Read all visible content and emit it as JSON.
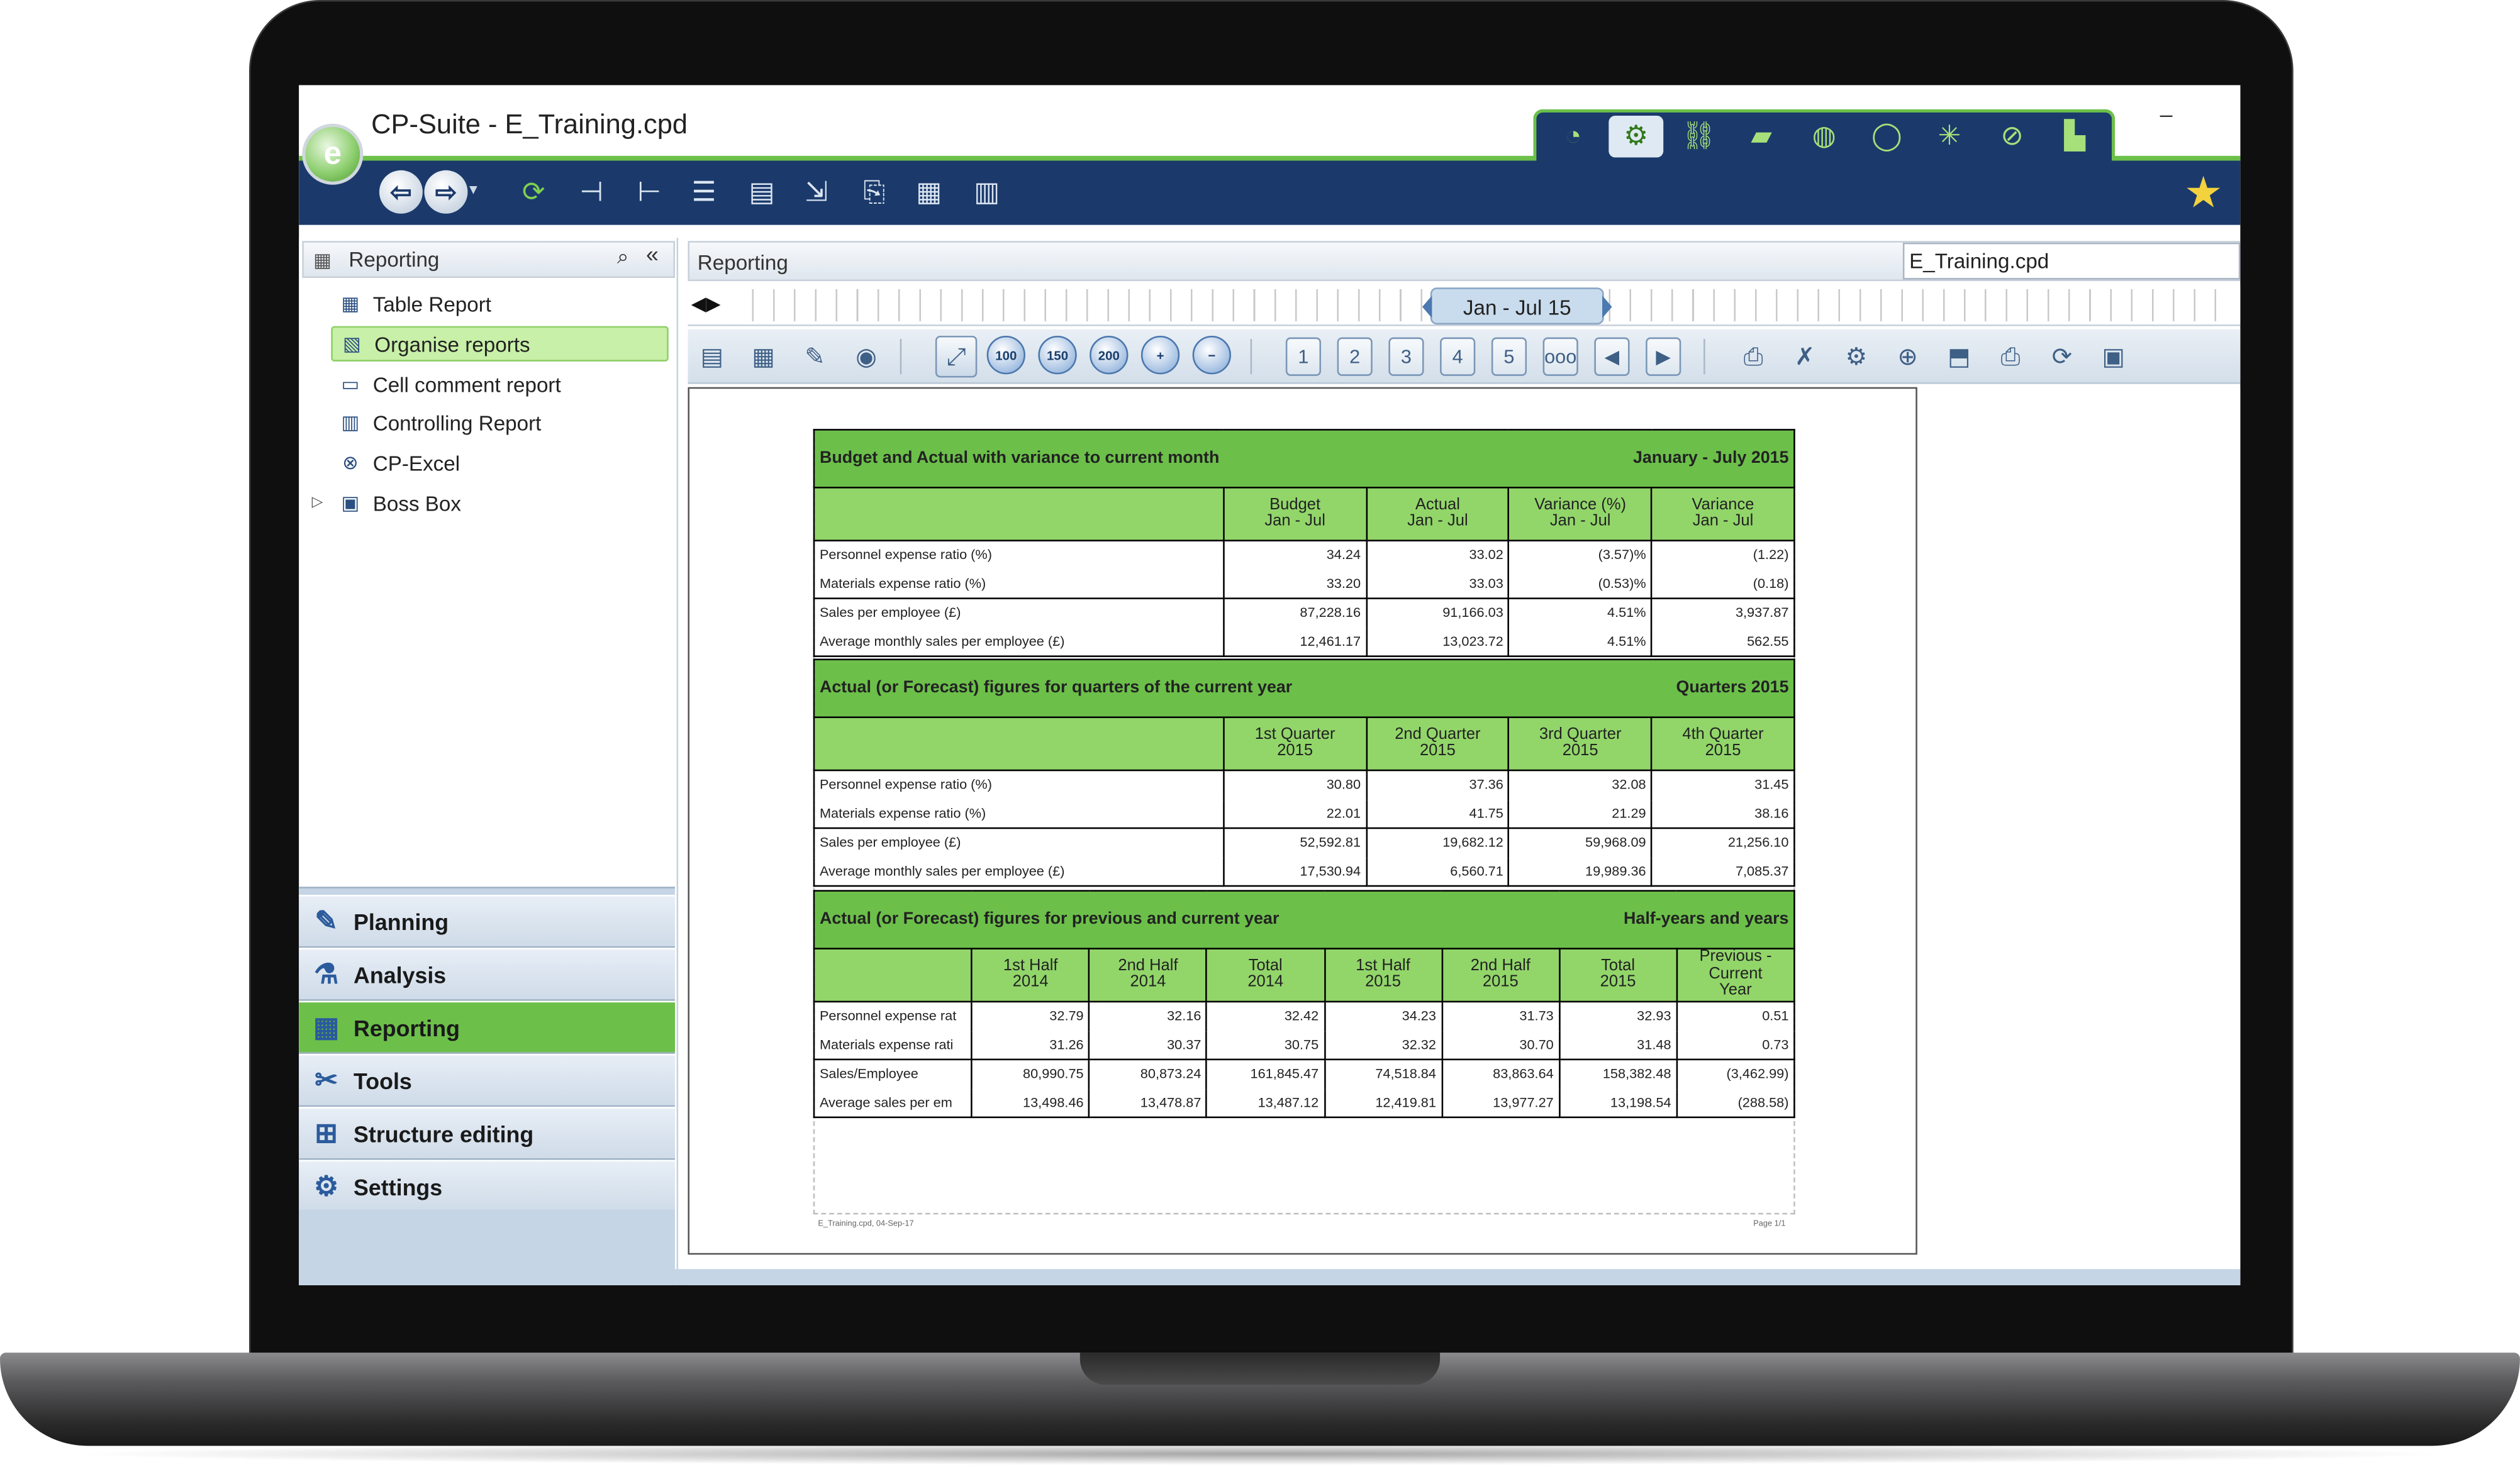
{
  "window": {
    "title": "CP-Suite - E_Training.cpd",
    "minimize_glyph": "–"
  },
  "module_tabs": [
    {
      "icon": "clock-icon",
      "glyph": "◔"
    },
    {
      "icon": "gears-icon",
      "glyph": "⚙"
    },
    {
      "icon": "link-icon",
      "glyph": "⛓"
    },
    {
      "icon": "money-icon",
      "glyph": "▰"
    },
    {
      "icon": "globe-icon",
      "glyph": "◍"
    },
    {
      "icon": "ring-icon",
      "glyph": "◯"
    },
    {
      "icon": "network-icon",
      "glyph": "✳"
    },
    {
      "icon": "compass-icon",
      "glyph": "⊘"
    },
    {
      "icon": "chart-users-icon",
      "glyph": "▙"
    }
  ],
  "toolbar": {
    "back_glyph": "⇦",
    "forward_glyph": "⇨",
    "drop_glyph": "▾",
    "icons": [
      {
        "name": "refresh-icon",
        "glyph": "⟳"
      },
      {
        "name": "tree-add-icon",
        "glyph": "⊣"
      },
      {
        "name": "tree-remove-icon",
        "glyph": "⊢"
      },
      {
        "name": "tree-structure-icon",
        "glyph": "☰"
      },
      {
        "name": "table-icon",
        "glyph": "▤"
      },
      {
        "name": "import-icon",
        "glyph": "⇲"
      },
      {
        "name": "export-icon",
        "glyph": "⎘"
      },
      {
        "name": "table-edit-icon",
        "glyph": "▦"
      },
      {
        "name": "grid-icon",
        "glyph": "▥"
      }
    ],
    "star_glyph": "★"
  },
  "left_panel": {
    "header": "Reporting",
    "header_icon": "▦",
    "search_glyph": "⌕",
    "collapse_glyph": "«",
    "expander_glyph": "▷",
    "tree": [
      {
        "label": "Table Report",
        "icon": "table-report-icon",
        "glyph": "▦"
      },
      {
        "label": "Organise reports",
        "icon": "organise-reports-icon",
        "glyph": "▧",
        "selected": true
      },
      {
        "label": "Cell comment report",
        "icon": "comment-icon",
        "glyph": "▭"
      },
      {
        "label": "Controlling Report",
        "icon": "controlling-report-icon",
        "glyph": "▥"
      },
      {
        "label": "CP-Excel",
        "icon": "excel-icon",
        "glyph": "⊗"
      },
      {
        "label": "Boss Box",
        "icon": "box-icon",
        "glyph": "▣"
      }
    ],
    "nav_sections": [
      {
        "label": "Planning",
        "icon": "planning-icon",
        "glyph": "✎"
      },
      {
        "label": "Analysis",
        "icon": "analysis-icon",
        "glyph": "⚗"
      },
      {
        "label": "Reporting",
        "icon": "reporting-icon",
        "glyph": "▦",
        "active": true
      },
      {
        "label": "Tools",
        "icon": "tools-icon",
        "glyph": "✂"
      },
      {
        "label": "Structure editing",
        "icon": "structure-icon",
        "glyph": "⊞"
      },
      {
        "label": "Settings",
        "icon": "settings-icon",
        "glyph": "⚙"
      }
    ]
  },
  "report_panel": {
    "header": "Reporting",
    "file": "E_Training.cpd",
    "period": "Jan - Jul 15",
    "timeline_arrows": "◀▶",
    "page_buttons": [
      "1",
      "2",
      "3",
      "4",
      "5",
      "ooo"
    ],
    "zoom_levels": [
      "100",
      "150",
      "200"
    ],
    "footer_left": "E_Training.cpd, 04-Sep-17",
    "footer_right": "Page 1/1"
  },
  "report": {
    "section1": {
      "title": "Budget and Actual with variance to current month",
      "period": "January - July 2015",
      "headers": [
        [
          "Budget",
          "Jan - Jul"
        ],
        [
          "Actual",
          "Jan - Jul"
        ],
        [
          "Variance (%)",
          "Jan - Jul"
        ],
        [
          "Variance",
          "Jan - Jul"
        ]
      ],
      "rows": [
        {
          "label": "Personnel expense ratio (%)",
          "values": [
            "34.24",
            "33.02",
            "(3.57)%",
            "(1.22)"
          ]
        },
        {
          "label": "Materials expense ratio (%)",
          "values": [
            "33.20",
            "33.03",
            "(0.53)%",
            "(0.18)"
          ]
        },
        {
          "label": "Sales per employee (£)",
          "values": [
            "87,228.16",
            "91,166.03",
            "4.51%",
            "3,937.87"
          ]
        },
        {
          "label": "Average monthly sales per employee (£)",
          "values": [
            "12,461.17",
            "13,023.72",
            "4.51%",
            "562.55"
          ]
        }
      ]
    },
    "section2": {
      "title": "Actual (or Forecast) figures for quarters of the current year",
      "period": "Quarters 2015",
      "headers": [
        [
          "1st Quarter",
          "2015"
        ],
        [
          "2nd Quarter",
          "2015"
        ],
        [
          "3rd Quarter",
          "2015"
        ],
        [
          "4th Quarter",
          "2015"
        ]
      ],
      "rows": [
        {
          "label": "Personnel expense ratio (%)",
          "values": [
            "30.80",
            "37.36",
            "32.08",
            "31.45"
          ]
        },
        {
          "label": "Materials expense ratio (%)",
          "values": [
            "22.01",
            "41.75",
            "21.29",
            "38.16"
          ]
        },
        {
          "label": "Sales per employee (£)",
          "values": [
            "52,592.81",
            "19,682.12",
            "59,968.09",
            "21,256.10"
          ]
        },
        {
          "label": "Average monthly sales per employee (£)",
          "values": [
            "17,530.94",
            "6,560.71",
            "19,989.36",
            "7,085.37"
          ]
        }
      ]
    },
    "section3": {
      "title": "Actual (or Forecast) figures for previous and current year",
      "period": "Half-years and years",
      "headers": [
        [
          "1st Half",
          "2014"
        ],
        [
          "2nd Half",
          "2014"
        ],
        [
          "Total",
          "2014"
        ],
        [
          "1st Half",
          "2015"
        ],
        [
          "2nd Half",
          "2015"
        ],
        [
          "Total",
          "2015"
        ],
        [
          "Previous - Current",
          "Year"
        ]
      ],
      "rows": [
        {
          "label": "Personnel expense rat",
          "values": [
            "32.79",
            "32.16",
            "32.42",
            "34.23",
            "31.73",
            "32.93",
            "0.51"
          ]
        },
        {
          "label": "Materials expense rati",
          "values": [
            "31.26",
            "30.37",
            "30.75",
            "32.32",
            "30.70",
            "31.48",
            "0.73"
          ]
        },
        {
          "label": "Sales/Employee",
          "values": [
            "80,990.75",
            "80,873.24",
            "161,845.47",
            "74,518.84",
            "83,863.64",
            "158,382.48",
            "(3,462.99)"
          ]
        },
        {
          "label": "Average sales per em",
          "values": [
            "13,498.46",
            "13,478.87",
            "13,487.12",
            "12,419.81",
            "13,977.27",
            "13,198.54",
            "(288.58)"
          ]
        }
      ]
    }
  },
  "colors": {
    "accent_green": "#6cc04a",
    "header_green": "#92d66a",
    "navy": "#1b3a6b"
  }
}
